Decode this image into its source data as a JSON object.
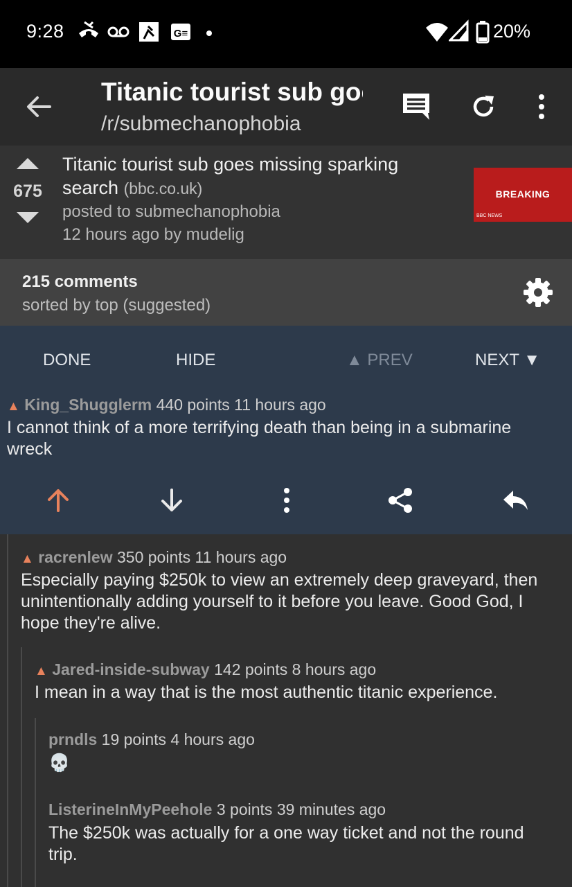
{
  "status_bar": {
    "time": "9:28",
    "battery": "20%"
  },
  "app_bar": {
    "title": "Titanic tourist sub goes missing sparking search",
    "subreddit": "/r/submechanophobia"
  },
  "post": {
    "score": "675",
    "title": "Titanic tourist sub goes missing sparking search",
    "domain": "(bbc.co.uk)",
    "posted_to": "posted to submechanophobia",
    "time_by": "12 hours ago by mudelig",
    "thumbnail": {
      "text": "BREAKING",
      "brand": "BBC NEWS"
    }
  },
  "comments_bar": {
    "count": "215 comments",
    "sort": "sorted by top (suggested)"
  },
  "nav": {
    "done": "DONE",
    "hide": "HIDE",
    "prev": "▲ PREV",
    "next": "NEXT ▼"
  },
  "comments": [
    {
      "user": "King_Shugglerm",
      "points": "440 points",
      "time": "11 hours ago",
      "text": "I cannot think of a more terrifying death than being in a submarine wreck"
    },
    {
      "user": "racrenlew",
      "points": "350 points",
      "time": "11 hours ago",
      "text": "Especially paying $250k to view an extremely deep graveyard, then unintentionally adding yourself to it before you leave. Good God, I hope they're alive."
    },
    {
      "user": "Jared-inside-subway",
      "points": "142 points",
      "time": "8 hours ago",
      "text": "I mean in a way that is the most authentic titanic experience."
    },
    {
      "user": "prndls",
      "points": "19 points",
      "time": "4 hours ago",
      "text": "💀"
    },
    {
      "user": "ListerineInMyPeehole",
      "points": "3 points",
      "time": "39 minutes ago",
      "text": "The $250k was actually for a one way ticket and not the round trip."
    }
  ],
  "colors": {
    "accent": "#e8825c",
    "selected_bg": "#2d3a4b",
    "bg": "#303030",
    "thumb_bg": "#b91c1c"
  },
  "icons": [
    "call-icon",
    "voicemail-icon",
    "app-icon",
    "translate-icon",
    "wifi-icon",
    "signal-icon",
    "battery-icon",
    "back-arrow-icon",
    "comment-icon",
    "refresh-icon",
    "more-vert-icon",
    "upvote-icon",
    "downvote-icon",
    "gear-icon",
    "share-icon",
    "reply-icon"
  ]
}
